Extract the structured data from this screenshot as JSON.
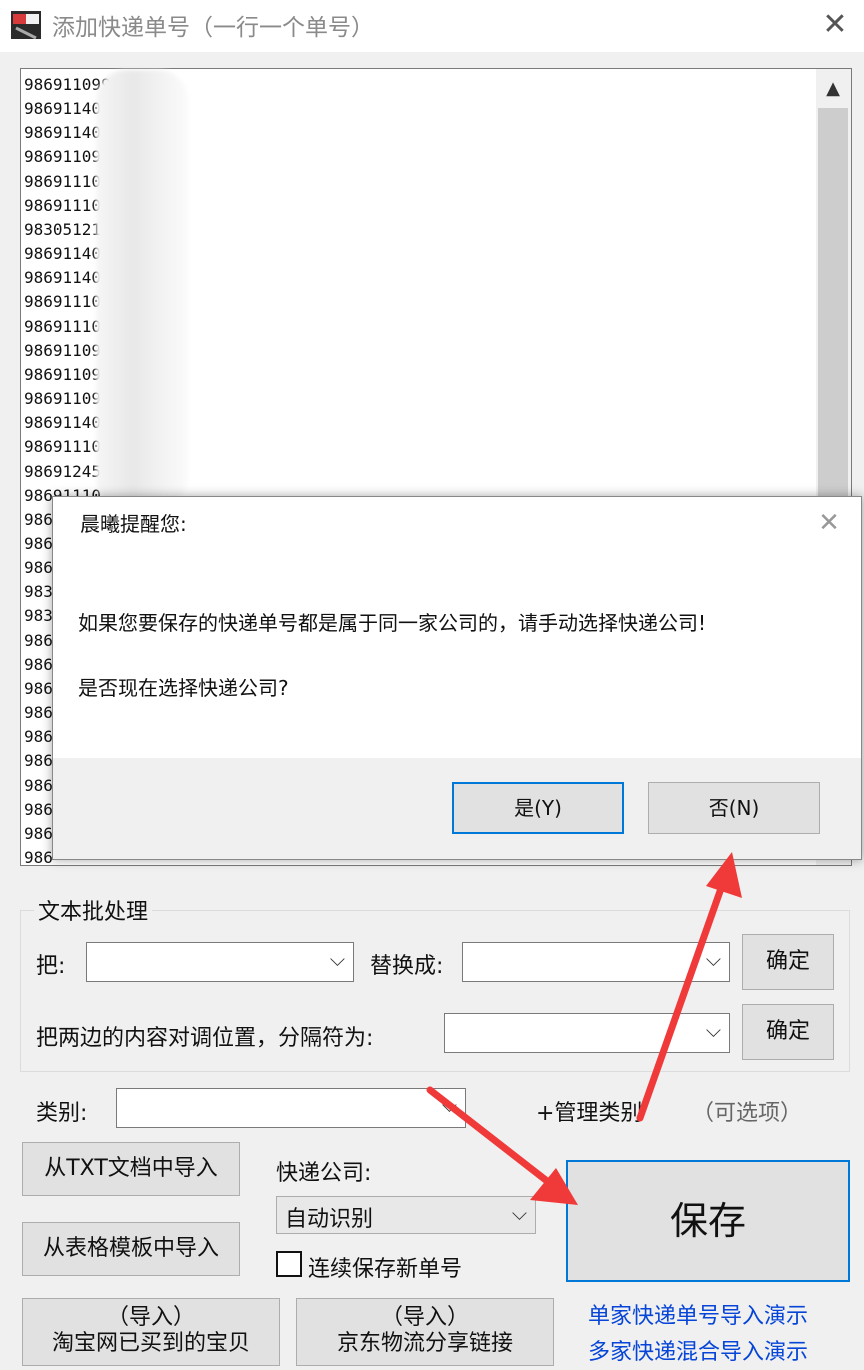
{
  "window": {
    "title": "添加快递单号（一行一个单号）",
    "close": "✕"
  },
  "textarea": {
    "lines": [
      "986911099",
      "986911404",
      "986911403",
      "986911098",
      "986911103",
      "986911103",
      "983051211",
      "986911404",
      "986911403",
      "9869111025",
      "9869111006",
      "986911099",
      "986911098",
      "986911099",
      "98691140",
      "98691110",
      "98691245",
      "98691110",
      "986",
      "986",
      "986",
      "983",
      "983",
      "986",
      "986",
      "986",
      "986",
      "986",
      "986",
      "986",
      "986",
      "986",
      "986",
      "986"
    ],
    "scroll_up": "▲"
  },
  "dialog": {
    "title": "晨曦提醒您:",
    "close": "✕",
    "message_line1": "如果您要保存的快递单号都是属于同一家公司的，请手动选择快递公司!",
    "message_line2": "是否现在选择快递公司?",
    "yes": "是(Y)",
    "no": "否(N)"
  },
  "batch": {
    "group_title": "文本批处理",
    "from_label": "把:",
    "replace_label": "替换成:",
    "confirm1": "确定",
    "swap_label": "把两边的内容对调位置，分隔符为:",
    "confirm2": "确定"
  },
  "category": {
    "label": "类别:",
    "manage": "+管理类别",
    "optional": "（可选项）"
  },
  "import": {
    "txt": "从TXT文档中导入",
    "template": "从表格模板中导入",
    "taobao_top": "（导入）",
    "taobao_bottom": "淘宝网已买到的宝贝",
    "jd_top": "（导入）",
    "jd_bottom": "京东物流分享链接"
  },
  "courier": {
    "label": "快递公司:",
    "selected": "自动识别",
    "continuous": "连续保存新单号"
  },
  "save": "保存",
  "links": {
    "single": "单家快递单号导入演示",
    "multi": "多家快递混合导入演示"
  },
  "colors": {
    "accent": "#0078d7",
    "link": "#0645d8",
    "annotation_arrow": "#f03a3a"
  }
}
